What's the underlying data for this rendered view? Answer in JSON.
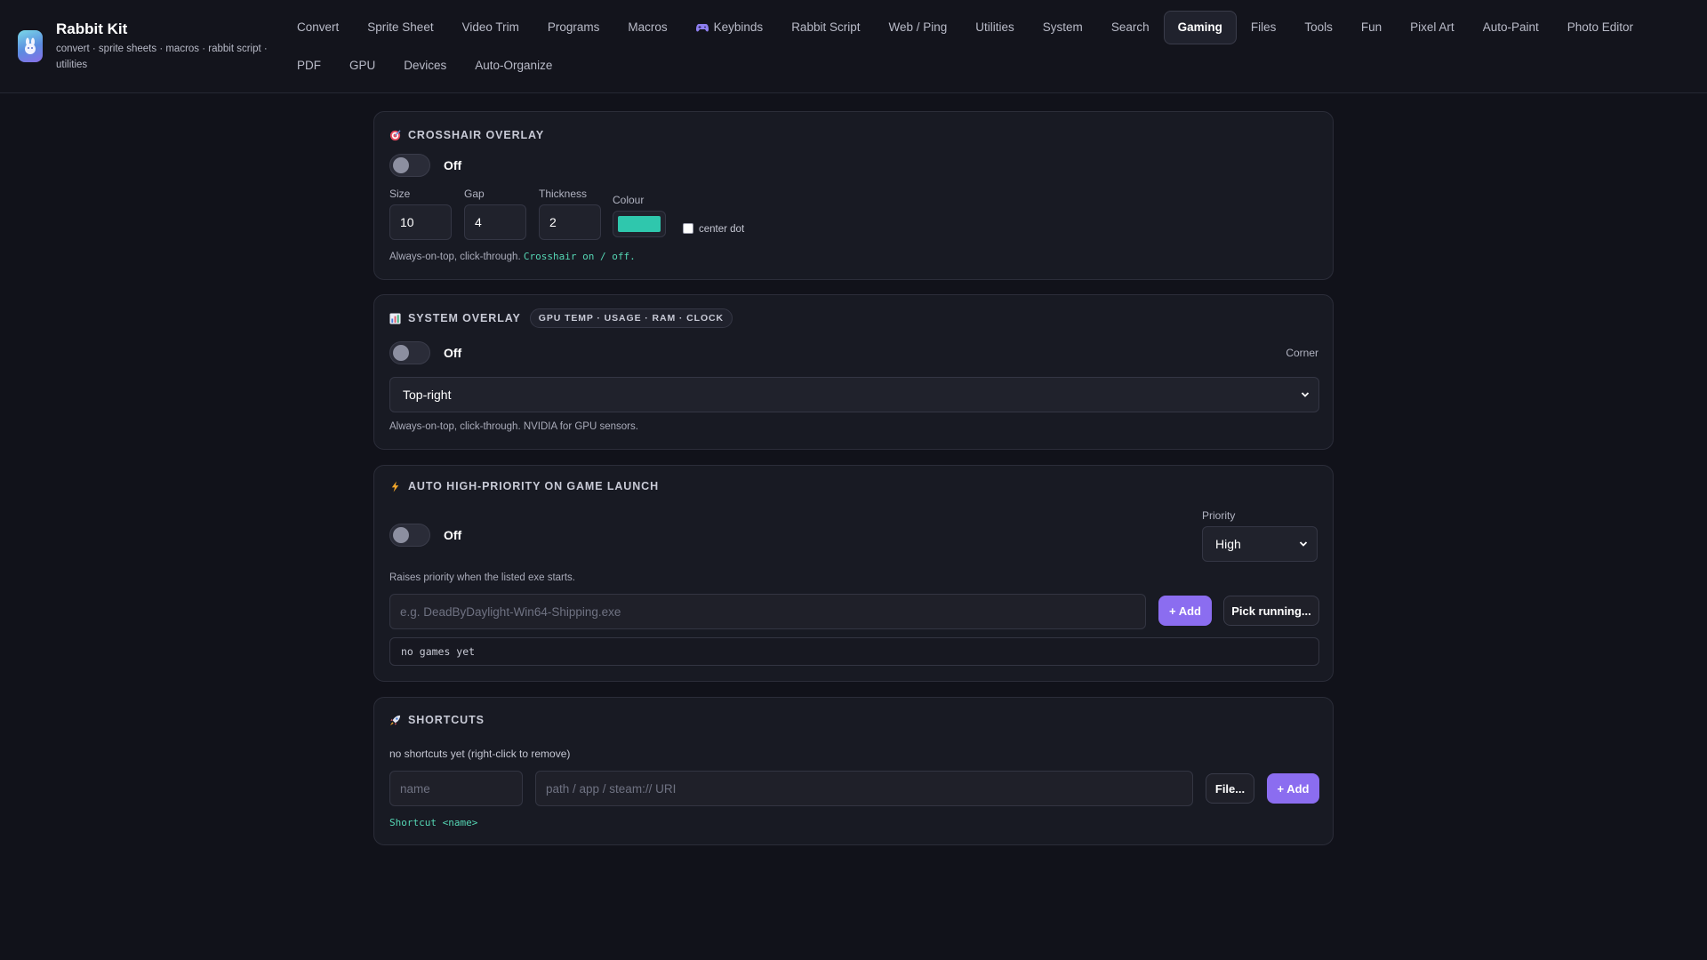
{
  "app": {
    "title": "Rabbit Kit",
    "subtitle": "convert · sprite sheets · macros · rabbit script · utilities"
  },
  "nav": {
    "row1": [
      {
        "label": "Convert",
        "icon": null
      },
      {
        "label": "Sprite Sheet",
        "icon": null
      },
      {
        "label": "Video Trim",
        "icon": null
      },
      {
        "label": "Programs",
        "icon": null
      },
      {
        "label": "Macros",
        "icon": null
      },
      {
        "label": "Keybinds",
        "icon": "gamepad-icon"
      },
      {
        "label": "Rabbit Script",
        "icon": null
      },
      {
        "label": "Web / Ping",
        "icon": null
      },
      {
        "label": "Utilities",
        "icon": null
      },
      {
        "label": "System",
        "icon": null
      },
      {
        "label": "Search",
        "icon": null
      },
      {
        "label": "Gaming",
        "icon": null
      },
      {
        "label": "Files",
        "icon": null
      },
      {
        "label": "Tools",
        "icon": null
      },
      {
        "label": "Fun",
        "icon": null
      },
      {
        "label": "Pixel Art",
        "icon": null
      },
      {
        "label": "Auto-Paint",
        "icon": null
      },
      {
        "label": "Photo Editor",
        "icon": null
      }
    ],
    "row2": [
      {
        "label": "PDF"
      },
      {
        "label": "GPU"
      },
      {
        "label": "Devices"
      },
      {
        "label": "Auto-Organize"
      }
    ],
    "active": "Gaming"
  },
  "crosshair": {
    "title": "CROSSHAIR OVERLAY",
    "icon": "target-icon",
    "toggle_state": "Off",
    "size_label": "Size",
    "size_value": "10",
    "gap_label": "Gap",
    "gap_value": "4",
    "thickness_label": "Thickness",
    "thickness_value": "2",
    "colour_label": "Colour",
    "colour_value": "#2fc7ad",
    "center_dot_label": "center dot",
    "center_dot_checked": false,
    "hint_prefix": "Always-on-top, click-through.",
    "hint_code": "Crosshair on / off."
  },
  "system_overlay": {
    "title": "SYSTEM OVERLAY",
    "icon": "bar-chart-icon",
    "pill": "GPU TEMP · USAGE · RAM · CLOCK",
    "toggle_state": "Off",
    "corner_label": "Corner",
    "corner_value": "Top-right",
    "hint": "Always-on-top, click-through. NVIDIA for GPU sensors."
  },
  "auto_priority": {
    "title": "AUTO HIGH-PRIORITY ON GAME LAUNCH",
    "icon": "lightning-icon",
    "toggle_state": "Off",
    "priority_label": "Priority",
    "priority_value": "High",
    "hint": "Raises priority when the listed exe starts.",
    "exe_placeholder": "e.g. DeadByDaylight-Win64-Shipping.exe",
    "add_label": "+ Add",
    "pick_label": "Pick running...",
    "empty_text": "no games yet"
  },
  "shortcuts": {
    "title": "SHORTCUTS",
    "icon": "rocket-icon",
    "empty_text": "no shortcuts yet (right-click to remove)",
    "name_placeholder": "name",
    "path_placeholder": "path / app / steam:// URI",
    "file_label": "File...",
    "add_label": "+ Add",
    "hint_code": "Shortcut <name>"
  },
  "colors": {
    "accent": "#8b6df0",
    "code_green": "#55d6b4",
    "background": "#11121a",
    "card": "#181a23"
  }
}
